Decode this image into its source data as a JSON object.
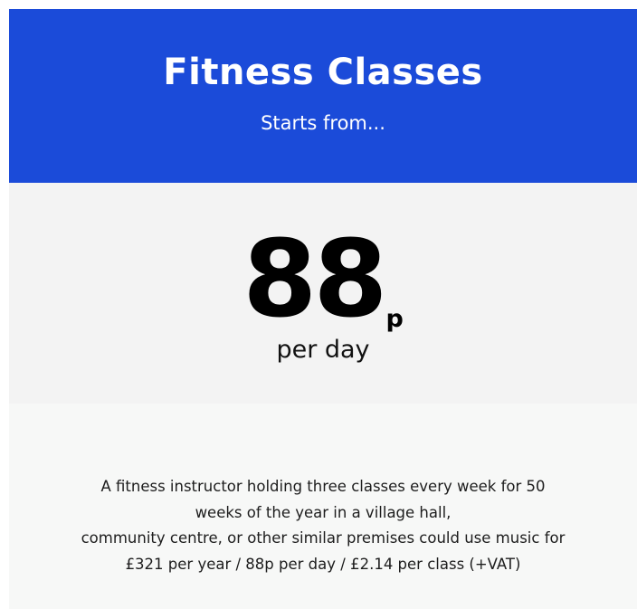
{
  "header": {
    "title": "Fitness Classes",
    "subtitle": "Starts from..."
  },
  "price": {
    "value": "88",
    "unit": "p",
    "period": "per day"
  },
  "description": {
    "lines": [
      "A fitness instructor holding three classes every week for 50",
      "weeks of the year in a village hall,",
      "community centre, or other similar premises could use music for",
      "£321 per year / 88p per day / £2.14 per class (+VAT)"
    ]
  },
  "colors": {
    "header_bg": "#1b4bd9",
    "header_text": "#ffffff",
    "price_panel_bg": "#f3f3f3",
    "desc_panel_bg": "#f7f8f7"
  }
}
